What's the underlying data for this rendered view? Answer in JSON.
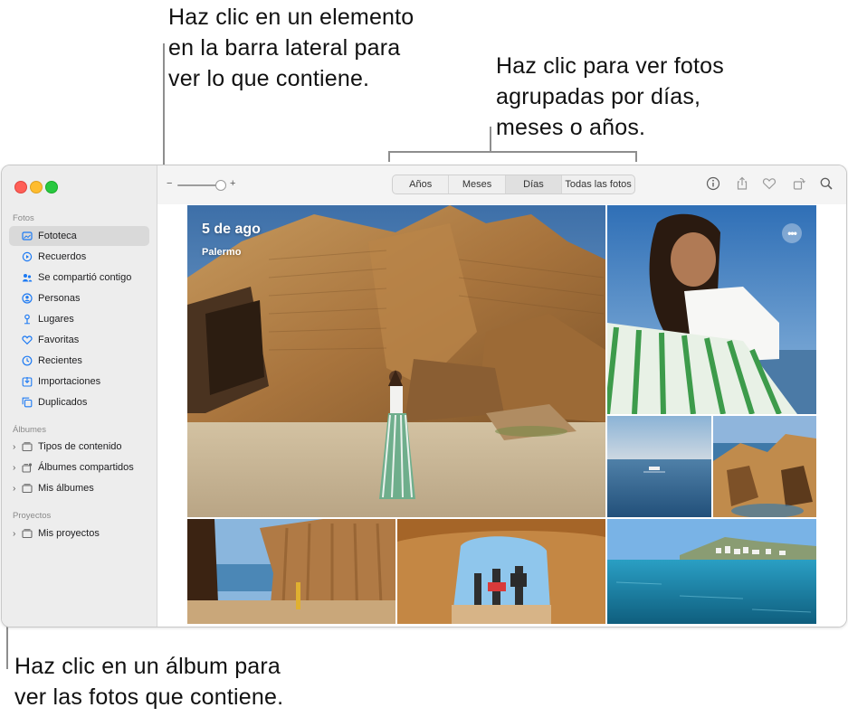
{
  "callouts": {
    "sidebar": [
      "Haz clic en un elemento",
      "en la barra lateral para",
      "ver lo que contiene."
    ],
    "view": [
      "Haz clic para ver fotos",
      "agrupadas por días,",
      "meses o años."
    ],
    "album": [
      "Haz clic en un álbum para",
      "ver las fotos que contiene."
    ]
  },
  "toolbar": {
    "zoom_minus": "−",
    "zoom_plus": "+",
    "segments": [
      "Años",
      "Meses",
      "Días",
      "Todas las fotos"
    ],
    "active_segment": "Días",
    "icons": [
      "info-icon",
      "share-icon",
      "heart-icon",
      "rotate-icon",
      "search-icon"
    ]
  },
  "sidebar": {
    "fotos_label": "Fotos",
    "items": [
      {
        "label": "Fototeca",
        "icon": "library-icon",
        "selected": true
      },
      {
        "label": "Recuerdos",
        "icon": "memories-icon"
      },
      {
        "label": "Se compartió contigo",
        "icon": "shared-with-you-icon"
      },
      {
        "label": "Personas",
        "icon": "people-icon"
      },
      {
        "label": "Lugares",
        "icon": "places-icon"
      },
      {
        "label": "Favoritas",
        "icon": "heart-icon"
      },
      {
        "label": "Recientes",
        "icon": "clock-icon"
      },
      {
        "label": "Importaciones",
        "icon": "import-icon"
      },
      {
        "label": "Duplicados",
        "icon": "duplicates-icon"
      }
    ],
    "albums_label": "Álbumes",
    "albums": [
      {
        "label": "Tipos de contenido",
        "icon": "folder-icon"
      },
      {
        "label": "Álbumes compartidos",
        "icon": "shared-albums-icon"
      },
      {
        "label": "Mis álbumes",
        "icon": "folder-icon"
      }
    ],
    "projects_label": "Proyectos",
    "projects": [
      {
        "label": "Mis proyectos",
        "icon": "folder-icon"
      }
    ]
  },
  "photo_grid": {
    "date": "5 de ago",
    "location": "Palermo",
    "more_label": "•••",
    "accent": "#1d7af3"
  }
}
